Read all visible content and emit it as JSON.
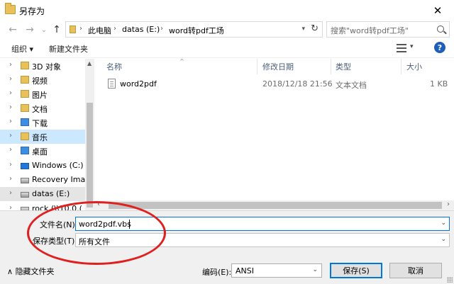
{
  "window": {
    "title": "另存为",
    "close_glyph": "✕"
  },
  "nav": {
    "back_glyph": "←",
    "forward_glyph": "→",
    "recent_glyph": "⌄",
    "up_glyph": "↑",
    "breadcrumbs": [
      "此电脑",
      "datas (E:)",
      "word转pdf工场"
    ],
    "breadcrumb_sep": "›",
    "search_placeholder": "搜索\"word转pdf工场\""
  },
  "toolbar": {
    "organize": "组织 ▾",
    "new_folder": "新建文件夹",
    "help": "?"
  },
  "tree": [
    {
      "label": "3D 对象",
      "icon": "folder-3d-icon"
    },
    {
      "label": "视频",
      "icon": "video-folder-icon"
    },
    {
      "label": "图片",
      "icon": "pictures-folder-icon"
    },
    {
      "label": "文档",
      "icon": "documents-folder-icon"
    },
    {
      "label": "下载",
      "icon": "download-folder-icon"
    },
    {
      "label": "音乐",
      "icon": "music-folder-icon"
    },
    {
      "label": "桌面",
      "icon": "desktop-folder-icon"
    },
    {
      "label": "Windows (C:)",
      "icon": "windows-drive-icon"
    },
    {
      "label": "Recovery Imag",
      "icon": "drive-icon"
    },
    {
      "label": "datas (E:)",
      "icon": "drive-icon"
    },
    {
      "label": "rock (\\\\10.0.(",
      "icon": "network-drive-icon"
    }
  ],
  "columns": {
    "name": "名称",
    "modified": "修改日期",
    "type": "类型",
    "size": "大小"
  },
  "files": [
    {
      "name": "word2pdf",
      "modified": "2018/12/18 21:56",
      "type": "文本文档",
      "size": "1 KB"
    }
  ],
  "save_form": {
    "filename_label": "文件名(N):",
    "filename_value": "word2pdf.vbs",
    "type_label": "保存类型(T):",
    "type_value": "所有文件",
    "hide_folders": "隐藏文件夹",
    "encoding_label": "编码(E):",
    "encoding_value": "ANSI",
    "save_button": "保存(S)",
    "cancel_button": "取消"
  },
  "colors": {
    "accent": "#0078d7",
    "annotation": "#e01f1f",
    "selection": "#cce8ff"
  }
}
